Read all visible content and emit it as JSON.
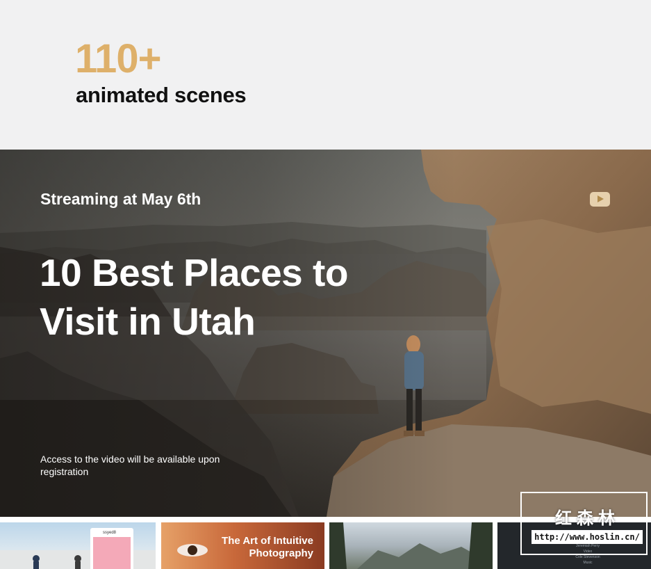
{
  "stats": {
    "number": "110+",
    "label": "animated scenes"
  },
  "hero": {
    "subtitle": "Streaming at May 6th",
    "title": "10 Best Places to Visit in Utah",
    "note": "Access to the video will be available upon registration",
    "play_icon": "play-icon"
  },
  "thumbnails": [
    {
      "card_user": "ssyed8"
    },
    {
      "title": "The Art of Intuitive Photography"
    },
    {},
    {
      "lines": [
        "Jeremiah Perry",
        "Video",
        "Cole Stevenson",
        "Music"
      ]
    }
  ],
  "watermark": {
    "cn": "红森林",
    "url": "http://www.hoslin.cn/"
  },
  "colors": {
    "accent": "#deb06a",
    "background": "#f1f1f2"
  }
}
